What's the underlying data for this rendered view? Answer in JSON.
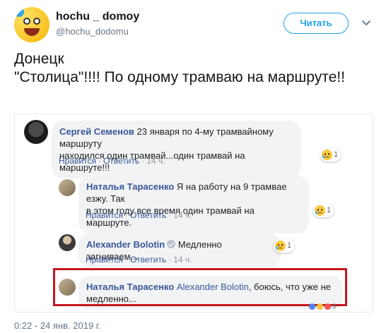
{
  "tweet": {
    "author_name": "hochu _ domoy",
    "handle": "@hochu_dodomu",
    "follow_label": "Читать",
    "text": "Донецк\n\"Столица\"!!!! По одному трамваю на маршруте!!",
    "timestamp": "0:22 - 24 янв. 2019 г."
  },
  "comments": [
    {
      "author": "Сергей Семенов",
      "text_line1": "23 января по 4-му трамвайному маршруту",
      "text_line2": "находился один трамвай...один трамвай на маршруте!!!",
      "like": "Нравится",
      "reply": "Ответить",
      "time": "14 ч.",
      "reaction_count": "1"
    },
    {
      "author": "Наталья Тарасенко",
      "text_line1": "Я на работу на 9 трамвае езжу. Так",
      "text_line2": "в этом году все время один трамвай на маршруте.",
      "like": "Нравится",
      "reply": "Ответить",
      "time": "14 ч.",
      "reaction_count": "1"
    },
    {
      "author": "Alexander Bolotin",
      "text_line1": "Медленно загниваем...",
      "like": "Нравится",
      "reply": "Ответить",
      "time": "14 ч.",
      "reaction_count": "1"
    },
    {
      "author": "Наталья Тарасенко",
      "mention": "Alexander Bolotin",
      "text_line1": ", боюсь, что уже не",
      "text_line2": "медленно...",
      "reaction_count": "3"
    }
  ],
  "colors": {
    "twitter_blue": "#1da1f2",
    "fb_link": "#385898",
    "highlight_red": "#c4171e"
  }
}
